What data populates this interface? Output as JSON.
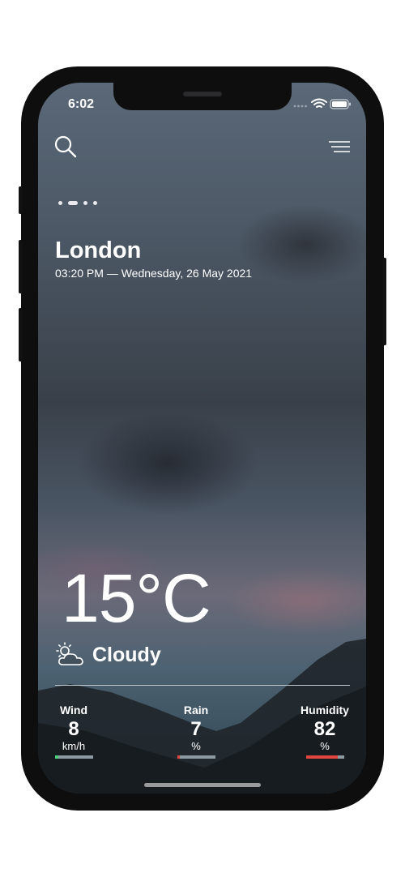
{
  "status_bar": {
    "time": "6:02"
  },
  "header": {
    "search_icon": "search-icon",
    "menu_icon": "menu-icon"
  },
  "pager": {
    "count": 4,
    "active_index": 1
  },
  "location": {
    "city": "London",
    "datetime": "03:20 PM — Wednesday, 26 May 2021"
  },
  "weather": {
    "temperature": "15°C",
    "condition": "Cloudy",
    "condition_icon": "partly-cloudy-icon"
  },
  "stats": [
    {
      "label": "Wind",
      "value": "8",
      "unit": "km/h",
      "level": 0.08,
      "color": "#4cd07d"
    },
    {
      "label": "Rain",
      "value": "7",
      "unit": "%",
      "level": 0.07,
      "color": "#e0463e"
    },
    {
      "label": "Humidity",
      "value": "82",
      "unit": "%",
      "level": 0.82,
      "color": "#e0463e"
    }
  ]
}
